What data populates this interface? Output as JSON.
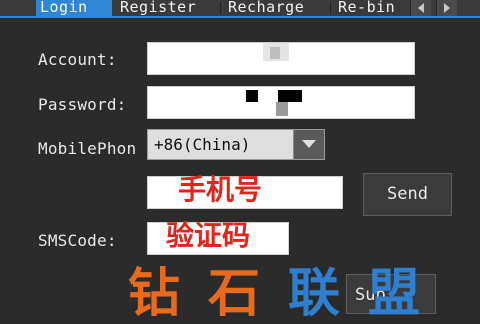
{
  "tabs": [
    {
      "label": "Login",
      "active": true
    },
    {
      "label": "Register",
      "active": false
    },
    {
      "label": "Recharge",
      "active": false
    },
    {
      "label": "Re-bin",
      "active": false
    }
  ],
  "form": {
    "account_label": "Account:",
    "password_label": "Password:",
    "mobile_label": "MobilePhon",
    "country_code": "+86(China)",
    "sms_label": "SMSCode:"
  },
  "buttons": {
    "send": "Send",
    "submit_partial": "Sub"
  },
  "overlays": {
    "phone_hint": "手机号",
    "code_hint": "验证码",
    "watermark_orange": "钻石",
    "watermark_blue": "联盟"
  },
  "colors": {
    "accent": "#2f86d6",
    "red": "#e0261a",
    "orange": "#e86a1c"
  }
}
